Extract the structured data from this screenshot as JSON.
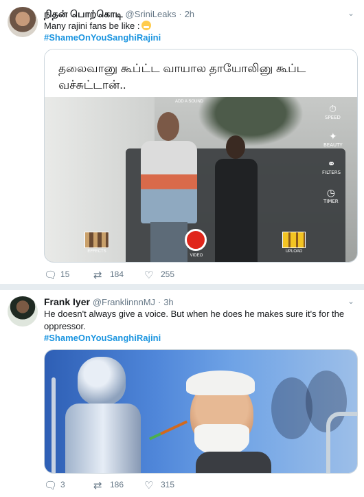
{
  "tweets": [
    {
      "author_name": "நிதன் பொற்கொடி",
      "handle": "@SriniLeaks",
      "time": "2h",
      "text": "Many rajini fans be like :",
      "emoji": "grinning-face-with-sweat",
      "hashtag": "#ShameOnYouSanghiRajini",
      "media": {
        "caption": "தலைவானு கூப்ட்ட வாயால தாயோலினு கூப்ட வச்சுட்டான்..",
        "overlay_add_sound": "ADD A SOUND",
        "overlay_effects": "EFFECTS",
        "overlay_video": "VIDEO",
        "overlay_upload": "UPLOAD",
        "overlay_speed": "SPEED",
        "overlay_beauty": "BEAUTY",
        "overlay_filters": "FILTERS",
        "overlay_timer": "TIMER"
      },
      "replies": "15",
      "retweets": "184",
      "likes": "255"
    },
    {
      "author_name": "Frank Iyer",
      "handle": "@FranklinnnMJ",
      "time": "3h",
      "text": "He doesn't always give a voice. But when he does he makes sure it's for the oppressor.",
      "hashtag": "#ShameOnYouSanghiRajini",
      "replies": "3",
      "retweets": "186",
      "likes": "315"
    }
  ],
  "colors": {
    "link": "#1b95e0",
    "muted": "#657786",
    "border": "#e6ecf0",
    "record": "#e0261b"
  },
  "icons": {
    "reply": "reply-icon",
    "retweet": "retweet-icon",
    "like": "heart-icon",
    "more": "chevron-down-icon"
  }
}
